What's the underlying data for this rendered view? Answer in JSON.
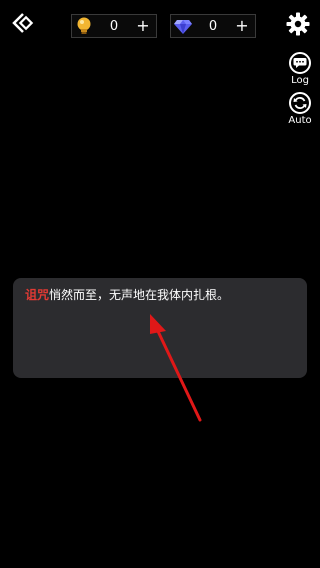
{
  "currencies": {
    "bulb": {
      "value": "0",
      "plus": "+",
      "icon": "lightbulb-icon"
    },
    "gem": {
      "value": "0",
      "plus": "+",
      "icon": "diamond-icon"
    }
  },
  "side_buttons": {
    "log": {
      "label": "Log",
      "icon": "chat-bubble-icon"
    },
    "auto": {
      "label": "Auto",
      "icon": "refresh-icon"
    }
  },
  "dialog": {
    "speaker": "诅咒",
    "text": "悄然而至，无声地在我体内扎根。"
  },
  "colors": {
    "speaker": "#e23a34",
    "dialog_bg": "#2c2c2f",
    "annotation_arrow": "#e01818"
  }
}
